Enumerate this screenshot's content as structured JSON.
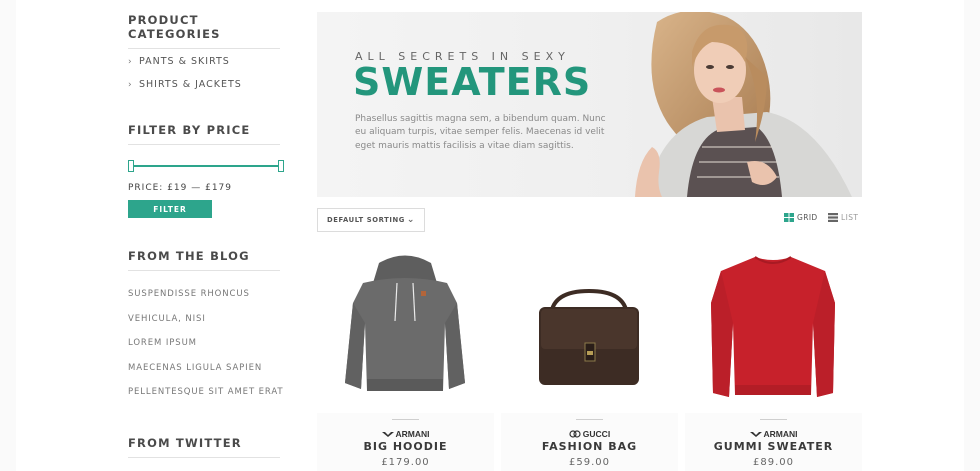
{
  "sidebar": {
    "categories_title": "PRODUCT CATEGORIES",
    "categories": [
      {
        "label": "PANTS & SKIRTS"
      },
      {
        "label": "SHIRTS & JACKETS"
      }
    ],
    "filter_title": "FILTER BY PRICE",
    "price_label": "PRICE: £19 — £179",
    "price_range": {
      "min": 19,
      "max": 179
    },
    "filter_button": "FILTER",
    "blog_title": "FROM THE BLOG",
    "blog_posts": [
      {
        "label": "SUSPENDISSE RHONCUS"
      },
      {
        "label": "VEHICULA, NISI"
      },
      {
        "label": "LOREM IPSUM"
      },
      {
        "label": "MAECENAS LIGULA SAPIEN"
      },
      {
        "label": "PELLENTESQUE SIT AMET ERAT"
      }
    ],
    "twitter_title": "FROM TWITTER"
  },
  "banner": {
    "subtitle": "ALL SECRETS IN SEXY",
    "title": "SWEATERS",
    "text": "Phasellus sagittis magna sem, a bibendum quam. Nunc eu aliquam turpis, vitae semper felis. Maecenas id velit eget mauris mattis facilisis a vitae diam sagittis."
  },
  "toolbar": {
    "sort_label": "DEFAULT SORTING",
    "grid_label": "GRID",
    "list_label": "LIST",
    "active_view": "grid"
  },
  "products": [
    {
      "brand": "ARMANI",
      "brand_icon": "armani-eagle-icon",
      "name": "BIG HOODIE",
      "price": "£179.00"
    },
    {
      "brand": "GUCCI",
      "brand_icon": "gucci-gg-icon",
      "name": "FASHION BAG",
      "price": "£59.00"
    },
    {
      "brand": "ARMANI",
      "brand_icon": "armani-eagle-icon",
      "name": "GUMMI SWEATER",
      "price": "£89.00"
    }
  ],
  "colors": {
    "accent": "#2da58c",
    "banner_title": "#23967c",
    "sweater_red": "#c7212b",
    "hoodie_gray": "#6b6b6b",
    "bag_brown": "#3d2c24"
  }
}
